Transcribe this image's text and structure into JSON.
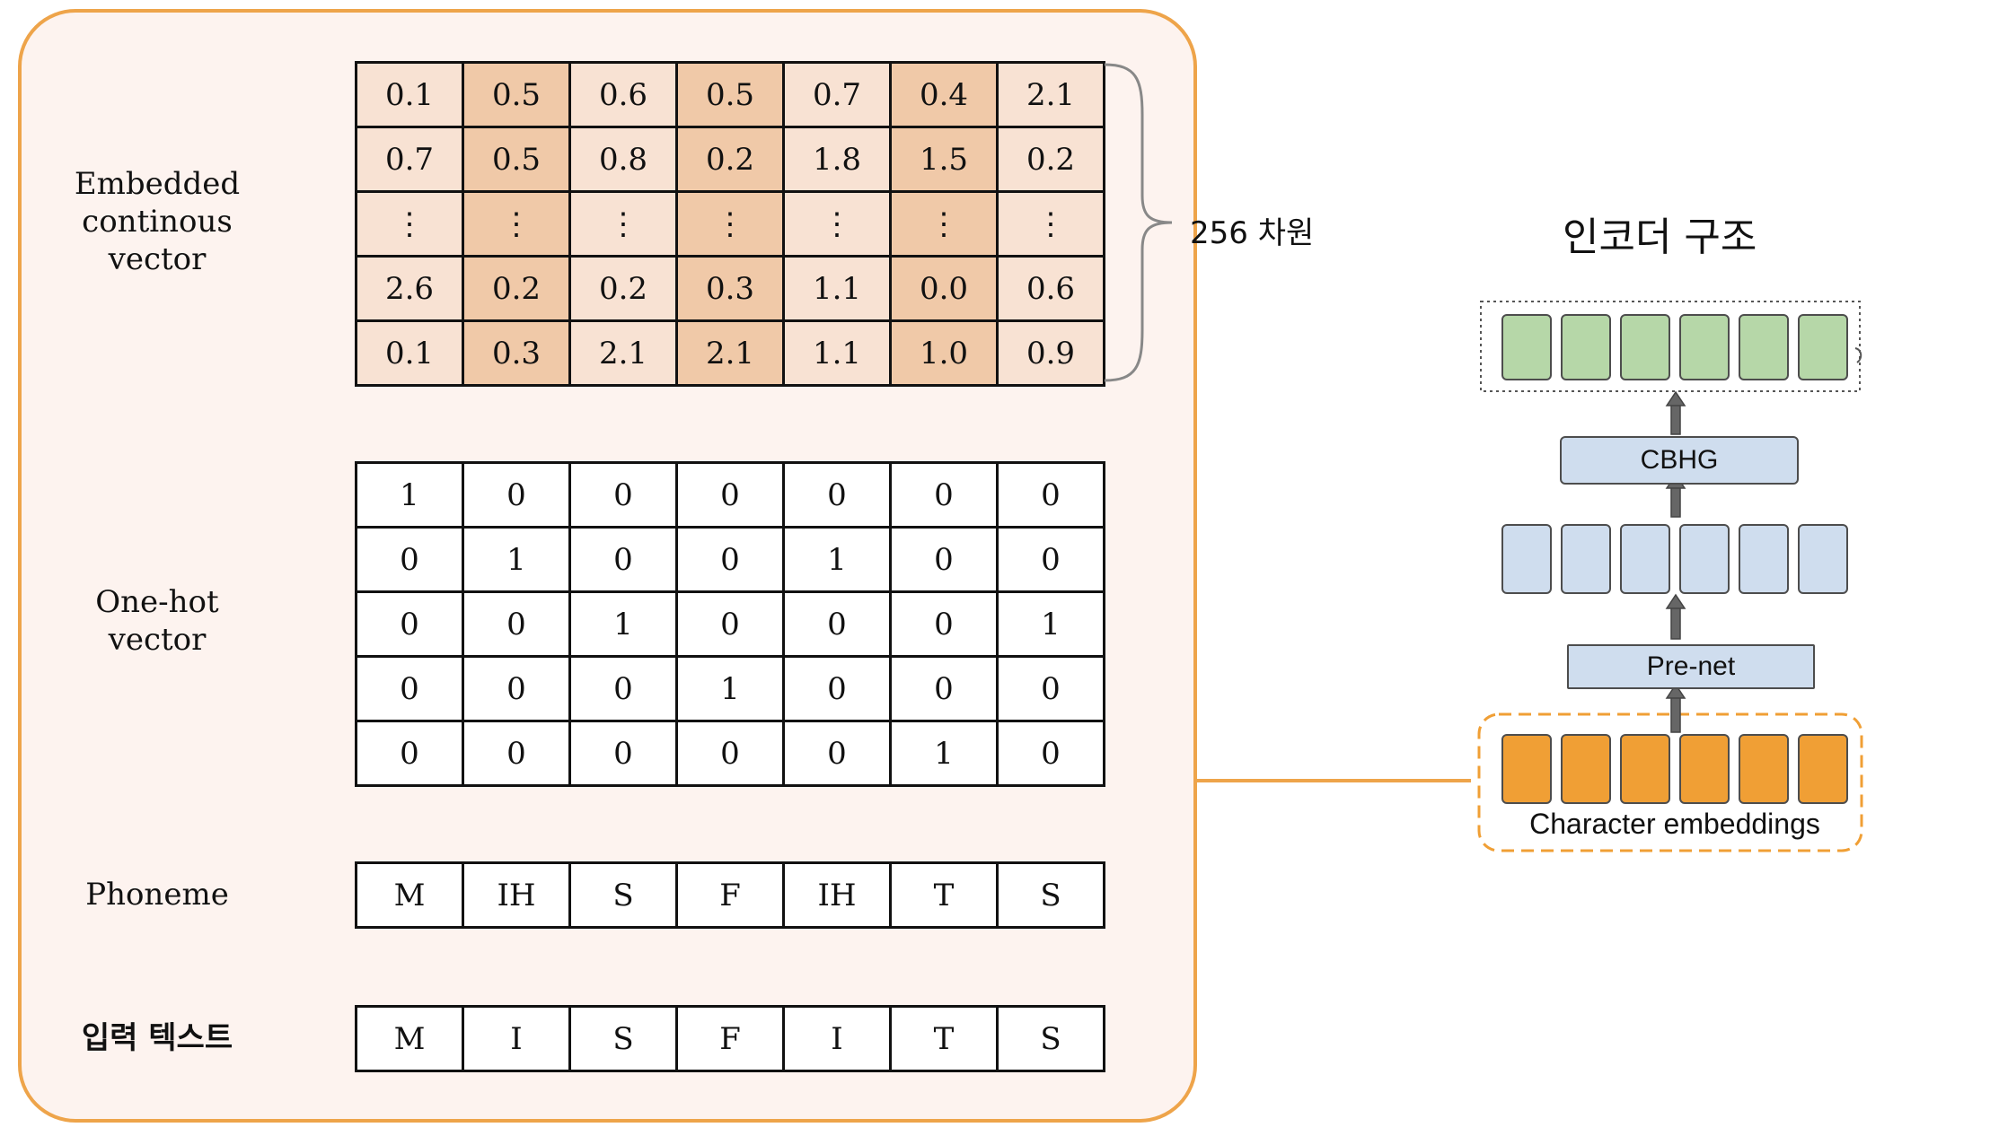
{
  "left_panel": {
    "labels": {
      "embedded": [
        "Embedded",
        "continous",
        "vector"
      ],
      "onehot": [
        "One-hot",
        "vector"
      ],
      "phoneme": "Phoneme",
      "input_text": "입력 텍스트"
    },
    "embedded_matrix": [
      [
        "0.1",
        "0.5",
        "0.6",
        "0.5",
        "0.7",
        "0.4",
        "2.1"
      ],
      [
        "0.7",
        "0.5",
        "0.8",
        "0.2",
        "1.8",
        "1.5",
        "0.2"
      ],
      [
        "⋮",
        "⋮",
        "⋮",
        "⋮",
        "⋮",
        "⋮",
        "⋮"
      ],
      [
        "2.6",
        "0.2",
        "0.2",
        "0.3",
        "1.1",
        "0.0",
        "0.6"
      ],
      [
        "0.1",
        "0.3",
        "2.1",
        "2.1",
        "1.1",
        "1.0",
        "0.9"
      ]
    ],
    "onehot_matrix": [
      [
        "1",
        "0",
        "0",
        "0",
        "0",
        "0",
        "0"
      ],
      [
        "0",
        "1",
        "0",
        "0",
        "1",
        "0",
        "0"
      ],
      [
        "0",
        "0",
        "1",
        "0",
        "0",
        "0",
        "1"
      ],
      [
        "0",
        "0",
        "0",
        "1",
        "0",
        "0",
        "0"
      ],
      [
        "0",
        "0",
        "0",
        "0",
        "0",
        "1",
        "0"
      ]
    ],
    "phonemes": [
      "M",
      "IH",
      "S",
      "F",
      "IH",
      "T",
      "S"
    ],
    "input_chars": [
      "M",
      "I",
      "S",
      "F",
      "I",
      "T",
      "S"
    ],
    "dimension_label": "256 차원"
  },
  "encoder": {
    "title": "인코더 구조",
    "cbhg_label": "CBHG",
    "prenet_label": "Pre-net",
    "char_embeddings_label": "Character embeddings"
  },
  "colors": {
    "panel_border": "#eea44a",
    "panel_bg": "#fdf3ef",
    "cell_light": "#f8e2d3",
    "cell_dark": "#f0c9a8",
    "green_block": "#b6d7a8",
    "blue_block": "#cfddee",
    "orange_block": "#f09f35"
  }
}
